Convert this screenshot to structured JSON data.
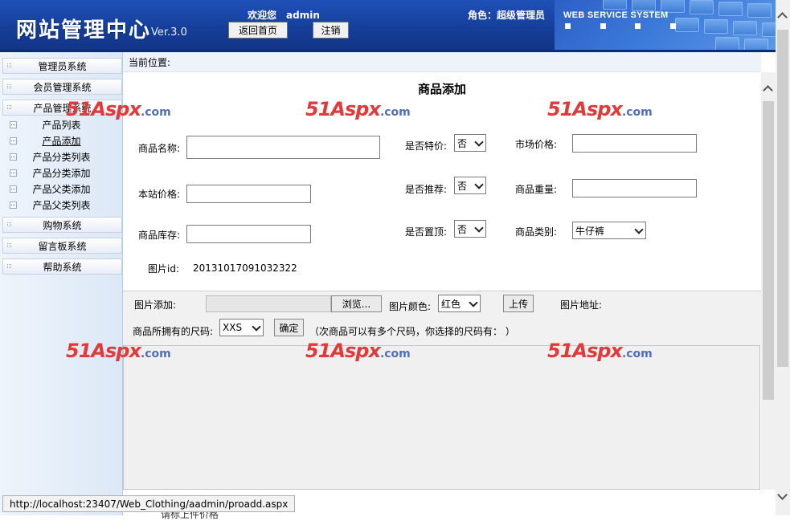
{
  "header": {
    "logo": "网站管理中心",
    "version": "Ver.3.0",
    "welcome_label": "欢迎您",
    "username": "admin",
    "home_button": "返回首页",
    "logout_button": "注销",
    "role": "角色：超级管理员",
    "system_name": "WEB SERVICE SYSTEM"
  },
  "sidebar": {
    "groups": [
      {
        "label": "管理员系统"
      },
      {
        "label": "会员管理系统"
      },
      {
        "label": "产品管理系统"
      },
      {
        "label": "购物系统"
      },
      {
        "label": "留言板系统"
      },
      {
        "label": "帮助系统"
      }
    ],
    "product_items": [
      {
        "label": "产品列表"
      },
      {
        "label": "产品添加"
      },
      {
        "label": "产品分类列表"
      },
      {
        "label": "产品分类添加"
      },
      {
        "label": "产品父类添加"
      },
      {
        "label": "产品父类列表"
      }
    ]
  },
  "breadcrumb": "当前位置:",
  "form": {
    "title": "商品添加",
    "name_label": "商品名称:",
    "special_label": "是否特价:",
    "special_value": "否",
    "market_price_label": "市场价格:",
    "site_price_label": "本站价格:",
    "recommend_label": "是否推荐:",
    "recommend_value": "否",
    "weight_label": "商品重量:",
    "stock_label": "商品库存:",
    "top_label": "是否置顶:",
    "top_value": "否",
    "category_label": "商品类别:",
    "category_value": "牛仔裤",
    "pic_id_label": "图片id:",
    "pic_id_value": "20131017091032322"
  },
  "upload": {
    "add_label": "图片添加:",
    "browse_button": "浏览...",
    "color_label": "图片颜色:",
    "color_value": "红色",
    "upload_button": "上传",
    "address_label": "图片地址:",
    "size_label": "商品所拥有的尺码:",
    "size_value": "XXS",
    "confirm_button": "确定",
    "size_hint": "（次商品可以有多个尺码，你选择的尺码有：  ）"
  },
  "watermark": {
    "num": "51",
    "asp": "Aspx",
    "dot": ".com"
  },
  "status_url": "http://localhost:23407/Web_Clothing/aadmin/proadd.aspx",
  "cut_text": "请标上件价格"
}
